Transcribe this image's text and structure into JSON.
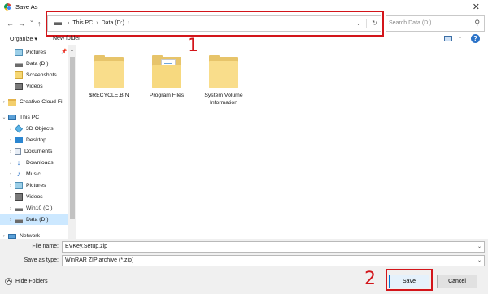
{
  "window": {
    "title": "Save As",
    "close_glyph": "✕"
  },
  "nav": {
    "back_glyph": "←",
    "forward_glyph": "→",
    "recent_glyph": "⌄",
    "up_glyph": "↑",
    "breadcrumb": [
      "This PC",
      "Data (D:)"
    ],
    "crumb_sep": "›",
    "addr_dropdown_glyph": "⌄",
    "refresh_glyph": "↻",
    "search_placeholder": "Search Data (D:)",
    "search_glyph": "⚲"
  },
  "toolbar": {
    "organize": "Organize ▾",
    "new_folder": "New folder",
    "view_caret": "▾",
    "help": "?"
  },
  "sidebar": {
    "items": [
      {
        "label": "Pictures",
        "icon": "pictures-icon",
        "chev": "",
        "pinned": true
      },
      {
        "label": "Data (D:)",
        "icon": "drive-icon",
        "chev": ""
      },
      {
        "label": "Screenshots",
        "icon": "folder-icon",
        "chev": ""
      },
      {
        "label": "Videos",
        "icon": "videos-icon",
        "chev": ""
      },
      {
        "label": "Creative Cloud Fil",
        "icon": "creative-cloud-icon",
        "chev": "›"
      },
      {
        "label": "This PC",
        "icon": "computer-icon",
        "chev": "⌄"
      },
      {
        "label": "3D Objects",
        "icon": "3d-objects-icon",
        "chev": "›"
      },
      {
        "label": "Desktop",
        "icon": "desktop-icon",
        "chev": "›"
      },
      {
        "label": "Documents",
        "icon": "documents-icon",
        "chev": "›"
      },
      {
        "label": "Downloads",
        "icon": "downloads-icon",
        "chev": "›"
      },
      {
        "label": "Music",
        "icon": "music-icon",
        "chev": "›"
      },
      {
        "label": "Pictures",
        "icon": "pictures-icon",
        "chev": "›"
      },
      {
        "label": "Videos",
        "icon": "videos-icon",
        "chev": "›"
      },
      {
        "label": "Win10 (C:)",
        "icon": "drive-icon",
        "chev": "›"
      },
      {
        "label": "Data (D:)",
        "icon": "drive-icon",
        "chev": "›",
        "selected": true
      },
      {
        "label": "Network",
        "icon": "network-icon",
        "chev": "›"
      }
    ],
    "pin_glyph": "📌"
  },
  "files": [
    {
      "name": "$RECYCLE.BIN",
      "icon": "folder-icon"
    },
    {
      "name": "Program Files",
      "icon": "folder-documents-icon"
    },
    {
      "name": "System Volume Information",
      "icon": "folder-icon"
    }
  ],
  "bottom": {
    "file_name_label": "File name:",
    "file_name_value": "EVKey.Setup.zip",
    "save_type_label": "Save as type:",
    "save_type_value": "WinRAR ZIP archive (*.zip)",
    "hide_folders": "Hide Folders",
    "save": "Save",
    "cancel": "Cancel",
    "caret": "⌄"
  },
  "annotations": {
    "marker_1": "1",
    "marker_2": "2",
    "color": "#d3151a"
  }
}
